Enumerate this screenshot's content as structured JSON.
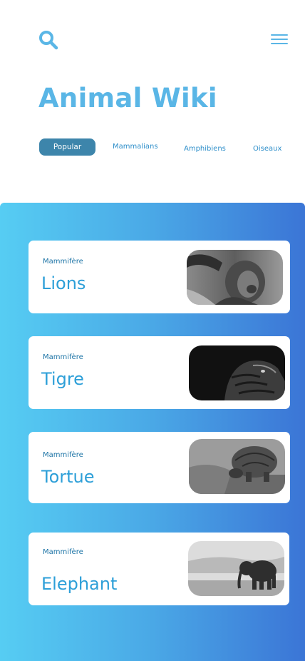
{
  "header": {
    "search_icon": "search-icon",
    "menu_icon": "menu-icon",
    "title": "Animal Wiki"
  },
  "tabs": [
    {
      "label": "Popular",
      "active": true
    },
    {
      "label": "Mammalians",
      "active": false
    },
    {
      "label": "Amphibiens",
      "active": false
    },
    {
      "label": "Oiseaux",
      "active": false
    }
  ],
  "cards": [
    {
      "category": "Mammifère",
      "name": "Lions",
      "image": "lion-photo"
    },
    {
      "category": "Mammifère",
      "name": "Tigre",
      "image": "tiger-photo"
    },
    {
      "category": "Mammifère",
      "name": "Tortue",
      "image": "tortoise-photo"
    },
    {
      "category": "Mammifère",
      "name": "Elephant",
      "image": "elephant-photo"
    }
  ],
  "colors": {
    "accent": "#5ab6e6",
    "tab_active": "#3d85ab",
    "gradient_start": "#56cdf3",
    "gradient_end": "#3b75d6"
  }
}
